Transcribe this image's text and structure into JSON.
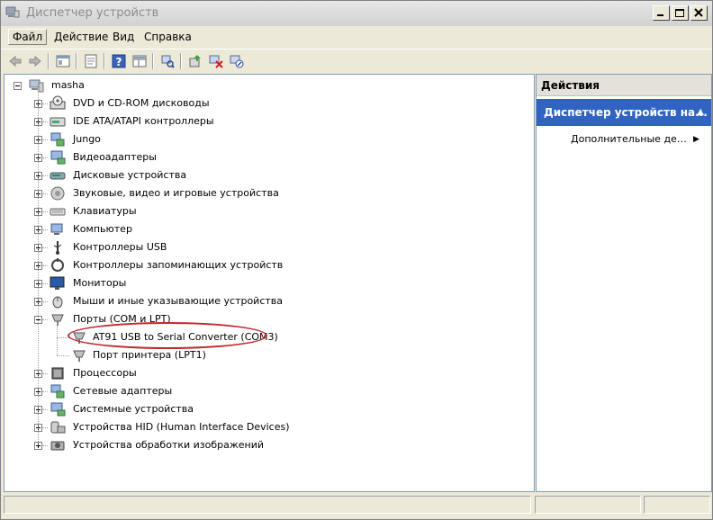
{
  "window": {
    "title": "Диспетчер устройств",
    "controls": [
      "minimize",
      "maximize",
      "close"
    ]
  },
  "menu": {
    "items": [
      "Файл",
      "Действие",
      "Вид",
      "Справка"
    ]
  },
  "toolbar": {
    "icons": [
      "back-icon",
      "forward-icon",
      "console-tree-icon",
      "properties-icon",
      "help-icon",
      "view-icon",
      "scan-hardware-icon",
      "update-driver-icon",
      "uninstall-icon",
      "disable-icon"
    ]
  },
  "tree": {
    "root": "masha",
    "categories": [
      {
        "label": "DVD и CD-ROM дисководы",
        "icon": "dvd-icon",
        "expanded": false
      },
      {
        "label": "IDE ATA/ATAPI контроллеры",
        "icon": "ide-icon",
        "expanded": false
      },
      {
        "label": "Jungo",
        "icon": "jungo-icon",
        "expanded": false
      },
      {
        "label": "Видеоадаптеры",
        "icon": "display-adapter-icon",
        "expanded": false
      },
      {
        "label": "Дисковые устройства",
        "icon": "disk-icon",
        "expanded": false
      },
      {
        "label": "Звуковые, видео и игровые устройства",
        "icon": "sound-icon",
        "expanded": false
      },
      {
        "label": "Клавиатуры",
        "icon": "keyboard-icon",
        "expanded": false
      },
      {
        "label": "Компьютер",
        "icon": "computer-icon",
        "expanded": false
      },
      {
        "label": "Контроллеры USB",
        "icon": "usb-icon",
        "expanded": false
      },
      {
        "label": "Контроллеры запоминающих устройств",
        "icon": "storage-icon",
        "expanded": false
      },
      {
        "label": "Мониторы",
        "icon": "monitor-icon",
        "expanded": false
      },
      {
        "label": "Мыши и иные указывающие устройства",
        "icon": "mouse-icon",
        "expanded": false
      },
      {
        "label": "Порты (COM и LPT)",
        "icon": "port-icon",
        "expanded": true
      },
      {
        "label": "Процессоры",
        "icon": "processor-icon",
        "expanded": false
      },
      {
        "label": "Сетевые адаптеры",
        "icon": "network-icon",
        "expanded": false
      },
      {
        "label": "Системные устройства",
        "icon": "system-icon",
        "expanded": false
      },
      {
        "label": "Устройства HID (Human Interface Devices)",
        "icon": "hid-icon",
        "expanded": false
      },
      {
        "label": "Устройства обработки изображений",
        "icon": "imaging-icon",
        "expanded": false
      }
    ],
    "ports_children": [
      {
        "label": "AT91 USB to Serial Converter (COM3)",
        "highlighted": true
      },
      {
        "label": "Порт принтера (LPT1)",
        "highlighted": false
      }
    ],
    "highlight_color": "#c0282a"
  },
  "actions": {
    "header": "Действия",
    "section": "Диспетчер устройств на...",
    "more": "Дополнительные действия"
  },
  "colors": {
    "section_bg": "#3164c2",
    "window_bg": "#ece9d8"
  }
}
